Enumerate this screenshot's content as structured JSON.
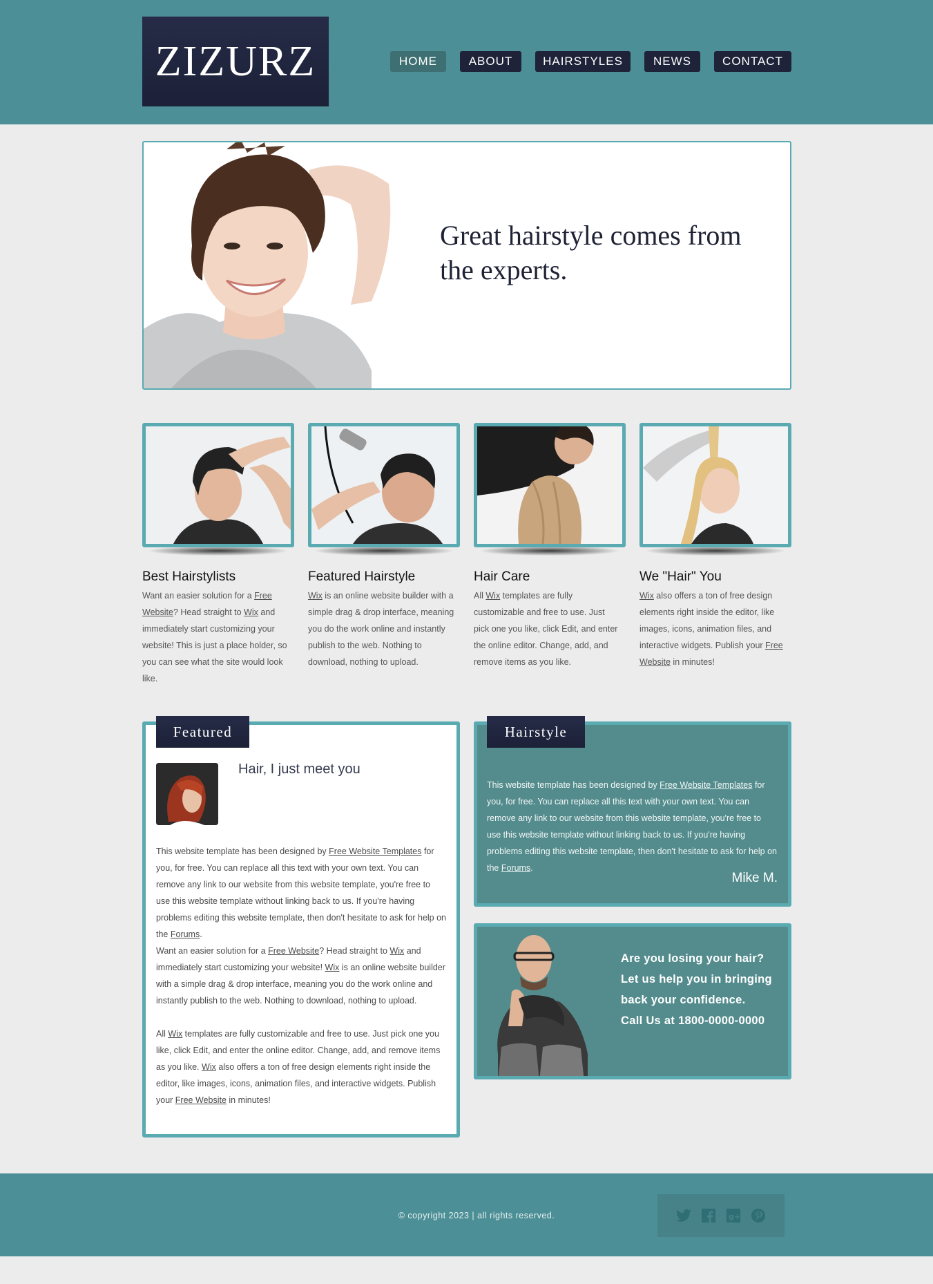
{
  "brand": {
    "logo": "ZIZURZ"
  },
  "nav": {
    "items": [
      {
        "label": "HOME",
        "active": true
      },
      {
        "label": "ABOUT",
        "active": false
      },
      {
        "label": "HAIRSTYLES",
        "active": false
      },
      {
        "label": "NEWS",
        "active": false
      },
      {
        "label": "CONTACT",
        "active": false
      }
    ]
  },
  "hero": {
    "headline": "Great hairstyle comes from the experts."
  },
  "cards": [
    {
      "title": "Best Hairstylists",
      "parts": [
        "Want an easier solution for a ",
        "Free Website",
        "? Head straight to ",
        "Wix",
        " and immediately start customizing your website! This is just a place holder, so you can see what the site would look like."
      ]
    },
    {
      "title": "Featured Hairstyle",
      "parts": [
        "",
        "Wix",
        " is an online website builder with a simple drag & drop interface, meaning you do the work online and instantly publish to the web. Nothing to download, nothing to upload."
      ]
    },
    {
      "title": "Hair Care",
      "parts": [
        "All ",
        "Wix",
        " templates are fully customizable and free to use. Just pick one you like, click Edit, and enter the online editor. Change, add, and remove items as you like."
      ]
    },
    {
      "title": "We \"Hair\" You",
      "parts": [
        "",
        "Wix",
        " also offers a ton of free design elements right inside the editor, like images, icons, animation files, and interactive widgets. Publish your ",
        "Free Website",
        " in minutes!"
      ]
    }
  ],
  "featured": {
    "tab": "Featured",
    "heading": "Hair, I just meet you",
    "p1": [
      "This website template has been designed by ",
      "Free Website Templates",
      " for you, for free. You can replace all this text with your own text. You can remove any link to our website from this website template, you're free to use this website template without linking back to us. If you're having problems editing this website template, then don't hesitate to ask for help on the ",
      "Forums",
      "."
    ],
    "p2": [
      "Want an easier solution for a ",
      "Free Website",
      "? Head straight to ",
      "Wix",
      " and immediately start customizing your website! ",
      "Wix",
      " is an online website builder with a simple drag & drop interface, meaning you do the work online and instantly publish to the web. Nothing to download, nothing to upload."
    ],
    "p3": [
      "All ",
      "Wix",
      " templates are fully customizable and free to use. Just pick one you like, click Edit, and enter the online editor. Change, add, and remove items as you like. ",
      "Wix",
      " also offers a ton of free design elements right inside the editor, like images, icons, animation files, and interactive widgets. Publish your ",
      "Free Website",
      " in minutes!"
    ]
  },
  "hairstyle": {
    "tab": "Hairstyle",
    "body": [
      "This website template has been designed by ",
      "Free Website Templates",
      " for you, for free. You can replace all this text with your own text. You can remove any link to our website from this website template, you're free to use this website template without linking back to us. If you're having problems editing this website template, then don't hesitate to ask for help on the ",
      "Forums",
      "."
    ],
    "author": "Mike M."
  },
  "promo": {
    "lines": [
      "Are you losing your hair?",
      "Let us help you in bringing back your confidence.",
      "Call Us at 1800-0000-0000"
    ]
  },
  "footer": {
    "copyright": "© copyright 2023 | all rights reserved.",
    "social": [
      "twitter-icon",
      "facebook-icon",
      "google-plus-icon",
      "pinterest-icon"
    ]
  },
  "colors": {
    "teal_header": "#4d8f96",
    "panel_border": "#5aaab2",
    "panel_teal": "#548c8d",
    "navy": "#1e2339",
    "background": "#ececec"
  }
}
